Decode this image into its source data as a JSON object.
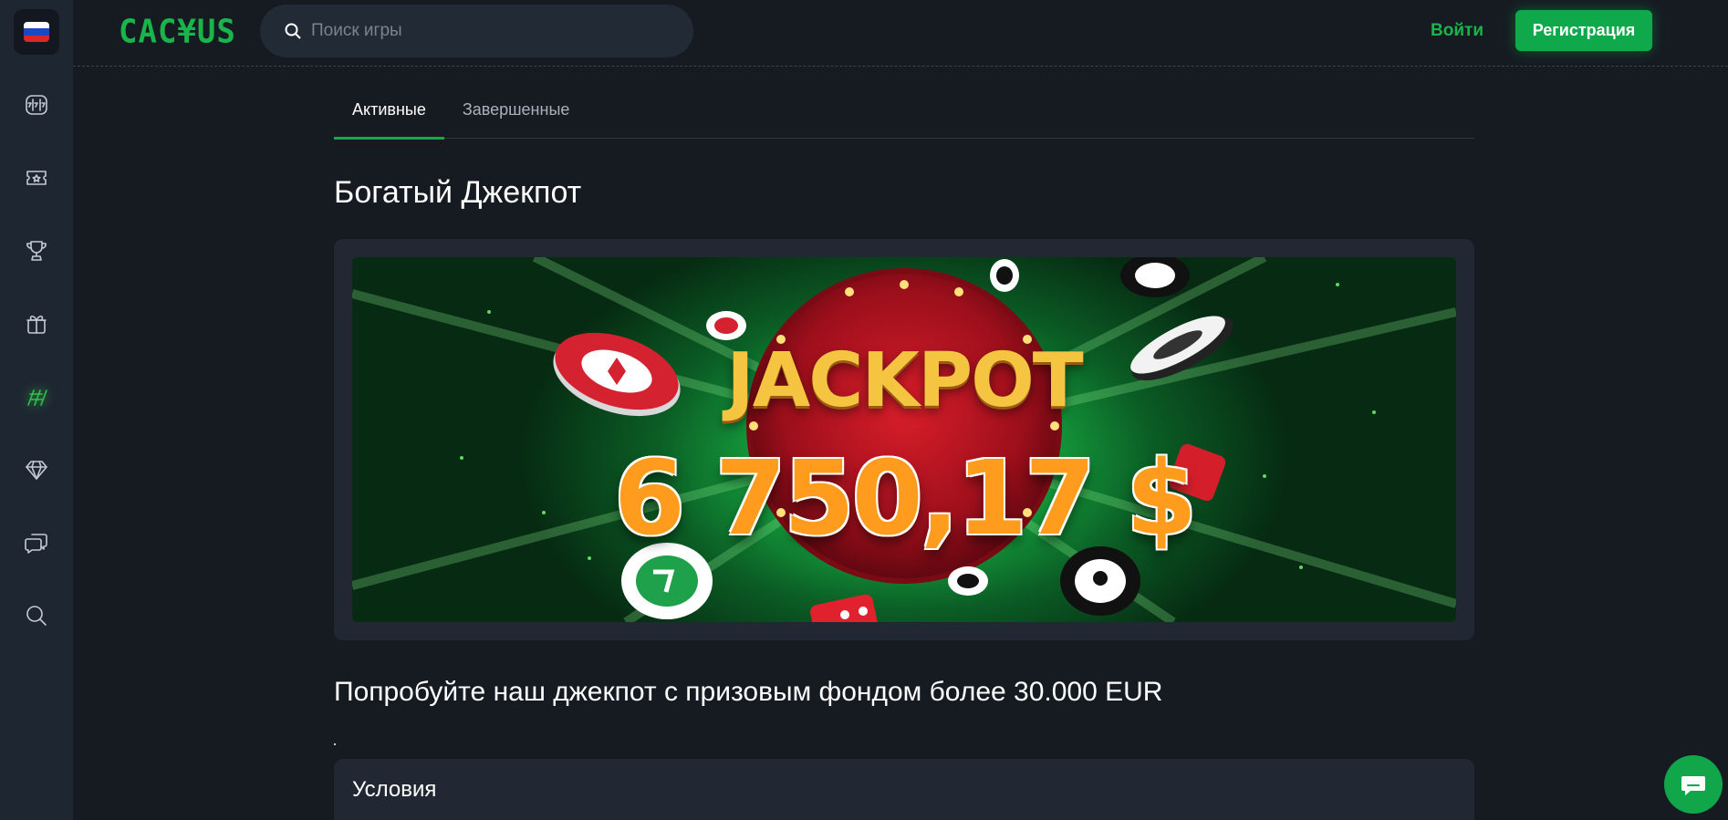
{
  "sidebar": {
    "language": "Русский",
    "colors": {
      "flag": [
        "#ffffff",
        "#1c48c4",
        "#d62828"
      ],
      "active": "#33c14a"
    },
    "items": [
      {
        "icon": "slot-machine-icon"
      },
      {
        "icon": "ticket-icon"
      },
      {
        "icon": "trophy-icon"
      },
      {
        "icon": "gift-icon"
      },
      {
        "icon": "cactus-jackpot-icon",
        "active": true
      },
      {
        "icon": "diamond-icon"
      },
      {
        "icon": "chat-bubbles-icon"
      },
      {
        "icon": "search-icon"
      }
    ]
  },
  "header": {
    "logo": "CAC¥US",
    "search_placeholder": "Поиск игры",
    "login_label": "Войти",
    "register_label": "Регистрация",
    "accent": "#19b54a"
  },
  "tabs": [
    {
      "label": "Активные",
      "active": true
    },
    {
      "label": "Завершенные",
      "active": false
    }
  ],
  "main": {
    "title": "Богатый Джекпот",
    "banner": {
      "word": "JACKPOT",
      "amount": "6 750,17 $"
    },
    "subtitle": "Попробуйте наш джекпот с призовым фондом более 30.000 EUR",
    "conditions_title": "Условия"
  },
  "chat_widget": {
    "icon": "chat-icon"
  }
}
